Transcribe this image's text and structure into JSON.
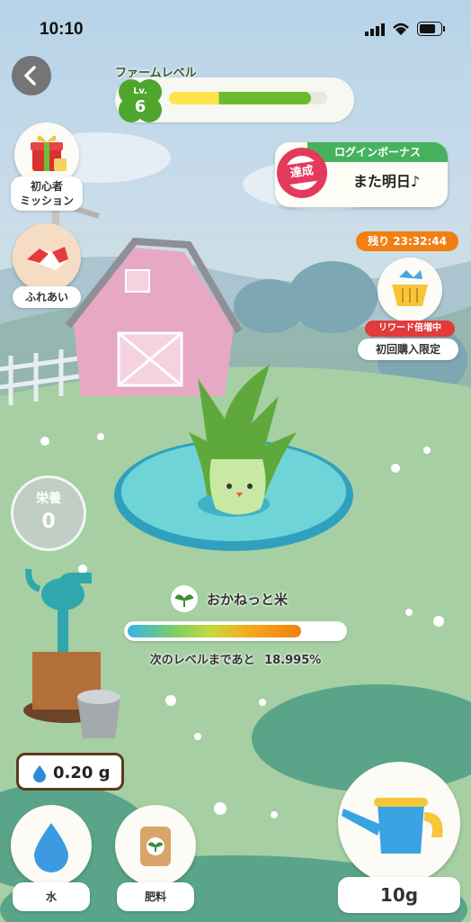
{
  "status_bar": {
    "time": "10:10"
  },
  "farm": {
    "title": "ファームレベル",
    "level_prefix": "Lv.",
    "level": "6",
    "progress": 0.9
  },
  "buttons": {
    "beginner_mission": "初心者\nミッション",
    "fureai": "ふれあい",
    "water": "水",
    "fertilizer": "肥料",
    "watering_can_amount": "10g"
  },
  "login_bonus": {
    "header": "ログインボーナス",
    "badge": "達成",
    "message": "また明日♪"
  },
  "shop": {
    "timer": "残り 23:32:44",
    "tag": "リワード倍増中",
    "label": "初回購入限定"
  },
  "nutrition": {
    "label": "栄養",
    "value": "0"
  },
  "plant": {
    "name": "おかねっと米",
    "growth_label": "次のレベルまであと",
    "growth_percent_text": "18.995%",
    "growth_fraction": 0.81
  },
  "water_store": {
    "amount": "0.20 g"
  },
  "colors": {
    "accent_green": "#47b25e",
    "login_badge": "#e33a5b",
    "timer_orange": "#f27f11"
  }
}
